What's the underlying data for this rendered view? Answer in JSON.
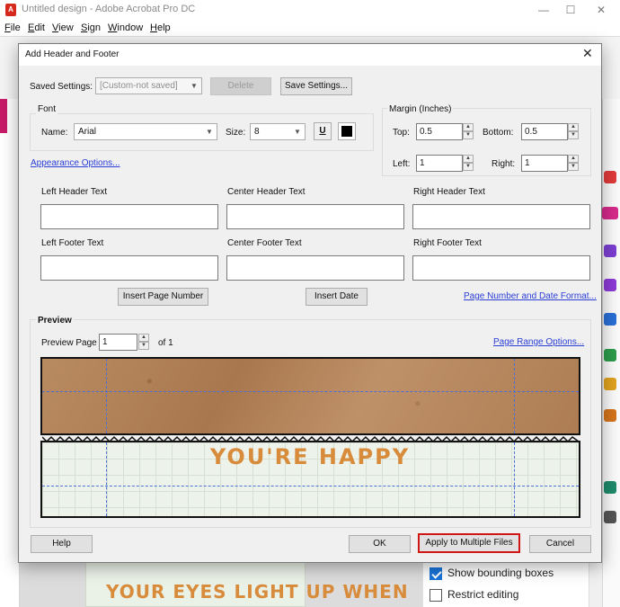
{
  "app": {
    "title": "Untitled design - Adobe Acrobat Pro DC",
    "logo_text": "A",
    "window_controls": {
      "minimize": "—",
      "maximize": "☐",
      "close": "✕"
    }
  },
  "menu": {
    "items": [
      {
        "underline": "F",
        "rest": "ile"
      },
      {
        "underline": "E",
        "rest": "dit"
      },
      {
        "underline": "V",
        "rest": "iew"
      },
      {
        "underline": "S",
        "rest": "ign"
      },
      {
        "underline": "W",
        "rest": "indow"
      },
      {
        "underline": "H",
        "rest": "elp"
      }
    ]
  },
  "background": {
    "page_text": "YOUR EYES LIGHT UP WHEN",
    "panel": {
      "show_bounding_boxes": {
        "label": "Show bounding boxes",
        "checked": true
      },
      "restrict_editing": {
        "label": "Restrict editing",
        "checked": false
      }
    }
  },
  "dialog": {
    "title": "Add Header and Footer",
    "close": "✕",
    "saved_settings": {
      "label": "Saved Settings:",
      "value": "[Custom-not saved]",
      "delete_label": "Delete",
      "save_label": "Save Settings..."
    },
    "font": {
      "group_label": "Font",
      "name_label": "Name:",
      "name_value": "Arial",
      "size_label": "Size:",
      "size_value": "8",
      "underline_glyph": "U",
      "color": "#000000"
    },
    "margin": {
      "group_label": "Margin (Inches)",
      "top_label": "Top:",
      "top_value": "0.5",
      "bottom_label": "Bottom:",
      "bottom_value": "0.5",
      "left_label": "Left:",
      "left_value": "1",
      "right_label": "Right:",
      "right_value": "1"
    },
    "appearance_link": "Appearance Options...",
    "fields": {
      "left_header": "Left Header Text",
      "center_header": "Center Header Text",
      "right_header": "Right Header Text",
      "left_footer": "Left Footer Text",
      "center_footer": "Center Footer Text",
      "right_footer": "Right Footer Text"
    },
    "insert_page_number": "Insert Page Number",
    "insert_date": "Insert Date",
    "page_number_format_link": "Page Number and Date Format...",
    "preview": {
      "group_label": "Preview",
      "page_label": "Preview Page",
      "page_value": "1",
      "of_label": "of 1",
      "range_link": "Page Range Options...",
      "sample_text": "YOU'RE HAPPY"
    },
    "buttons": {
      "help": "Help",
      "ok": "OK",
      "apply_multiple": "Apply to Multiple Files",
      "cancel": "Cancel"
    }
  },
  "colors": {
    "highlight": "#d11414",
    "link": "#2a3ed6",
    "accent_pink": "#c81b67",
    "text_orange": "#d78b3b"
  }
}
